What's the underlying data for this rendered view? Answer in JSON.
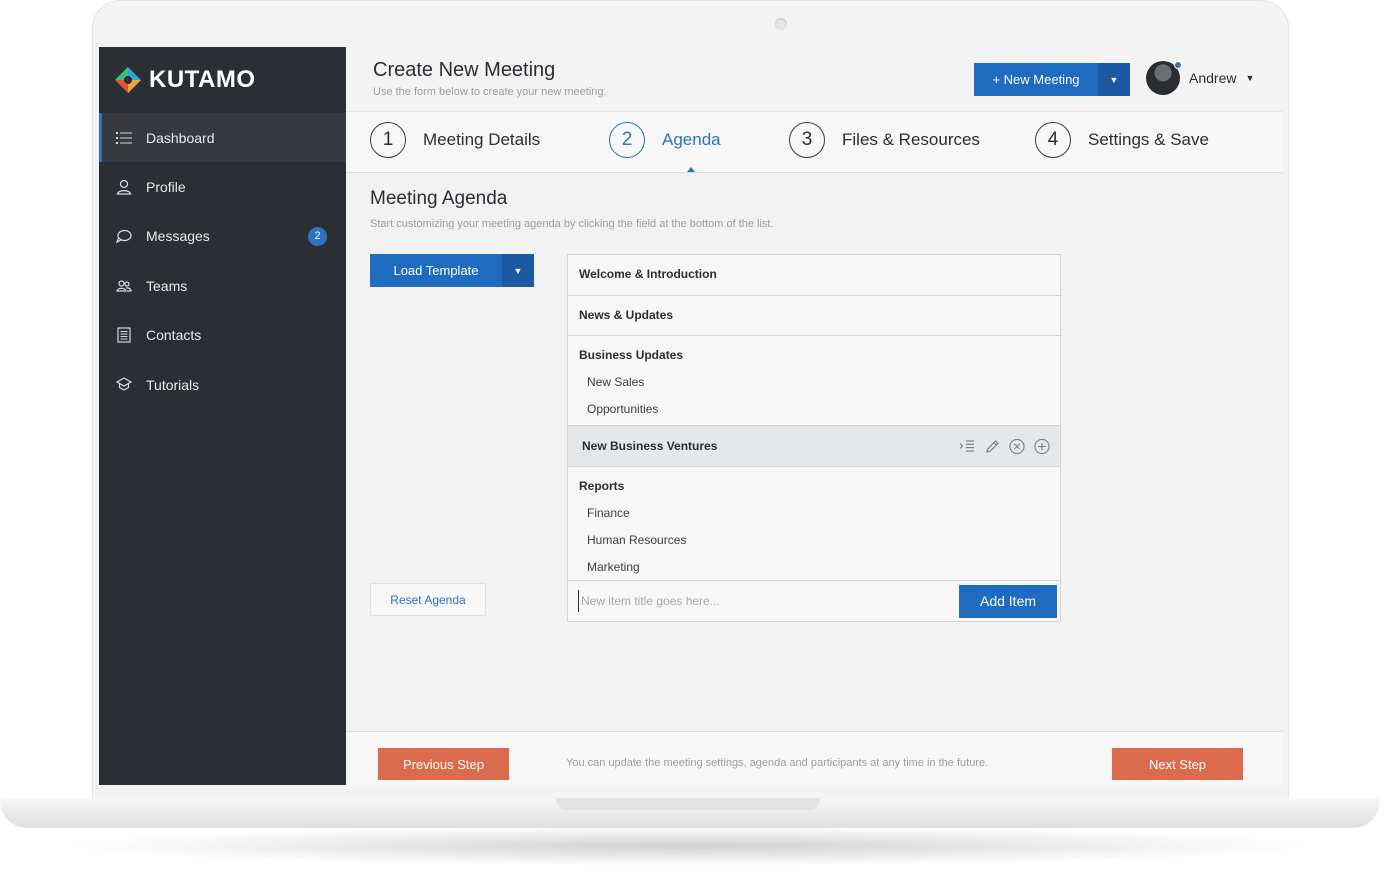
{
  "app": {
    "logo": "KUTAMO"
  },
  "sidebar": {
    "items": [
      {
        "label": "Dashboard",
        "icon": "list-icon",
        "active": true
      },
      {
        "label": "Profile",
        "icon": "user-icon"
      },
      {
        "label": "Messages",
        "icon": "chat-icon",
        "badge": "2"
      },
      {
        "label": "Teams",
        "icon": "team-icon"
      },
      {
        "label": "Contacts",
        "icon": "contacts-icon"
      },
      {
        "label": "Tutorials",
        "icon": "graduation-cap-icon"
      }
    ]
  },
  "header": {
    "title": "Create New Meeting",
    "subtitle": "Use the form below to create your new meeting.",
    "new_meeting_label": "+ New Meeting",
    "user_name": "Andrew"
  },
  "steps": [
    {
      "number": "1",
      "label": "Meeting Details"
    },
    {
      "number": "2",
      "label": "Agenda",
      "active": true
    },
    {
      "number": "3",
      "label": "Files & Resources"
    },
    {
      "number": "4",
      "label": "Settings & Save"
    }
  ],
  "main": {
    "title": "Meeting Agenda",
    "description": "Start customizing your meeting agenda by clicking the field at the bottom of the list.",
    "load_template_label": "Load Template",
    "reset_agenda_label": "Reset Agenda"
  },
  "agenda": {
    "items": [
      {
        "title": "Welcome & Introduction",
        "sub": []
      },
      {
        "title": "News & Updates",
        "sub": []
      },
      {
        "title": "Business Updates",
        "sub": [
          "New Sales",
          "Opportunities"
        ]
      },
      {
        "title": "New Business Ventures",
        "sub": []
      },
      {
        "title": "Reports",
        "sub": [
          "Finance",
          "Human Resources",
          "Marketing"
        ]
      }
    ],
    "new_item_placeholder": "New item title goes here...",
    "add_item_label": "Add Item"
  },
  "footer": {
    "previous_label": "Previous Step",
    "next_label": "Next Step",
    "note": "You can update the meeting settings, agenda and participants at any time in the future."
  },
  "colors": {
    "accent": "#1e6bbf",
    "cta": "#dc6a4c",
    "sidebar_bg": "#2b2e33"
  }
}
